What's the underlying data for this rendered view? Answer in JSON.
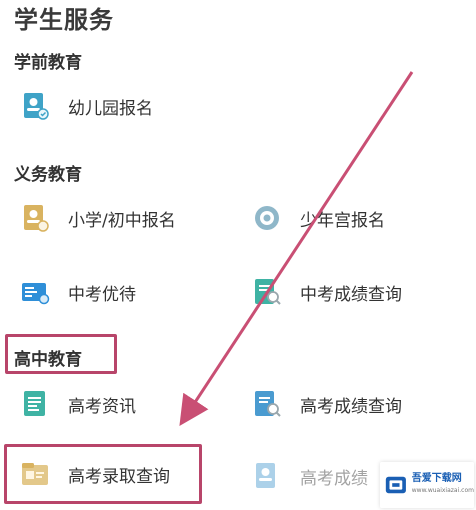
{
  "title": "学生服务",
  "sections": {
    "preschool": {
      "title": "学前教育",
      "items": [
        {
          "label": "幼儿园报名",
          "icon": "document-person-icon"
        }
      ]
    },
    "compulsory": {
      "title": "义务教育",
      "items": [
        {
          "label": "小学/初中报名",
          "icon": "document-person-icon"
        },
        {
          "label": "少年宫报名",
          "icon": "gear-badge-icon"
        },
        {
          "label": "中考优待",
          "icon": "id-card-icon"
        },
        {
          "label": "中考成绩查询",
          "icon": "document-search-icon"
        }
      ]
    },
    "highschool": {
      "title": "高中教育",
      "items": [
        {
          "label": "高考资讯",
          "icon": "document-lines-icon"
        },
        {
          "label": "高考成绩查询",
          "icon": "document-search-icon"
        },
        {
          "label": "高考录取查询",
          "icon": "folder-card-icon"
        },
        {
          "label": "高考成绩",
          "icon": "document-person-icon"
        }
      ]
    }
  },
  "watermark": {
    "text": "吾爱下载网",
    "sub": "www.wuaixiazai.com"
  },
  "colors": {
    "highlight": "#b8456a",
    "icon_blue": "#2f8fd8",
    "icon_teal": "#3fb3a4",
    "icon_gold": "#d9b360"
  }
}
